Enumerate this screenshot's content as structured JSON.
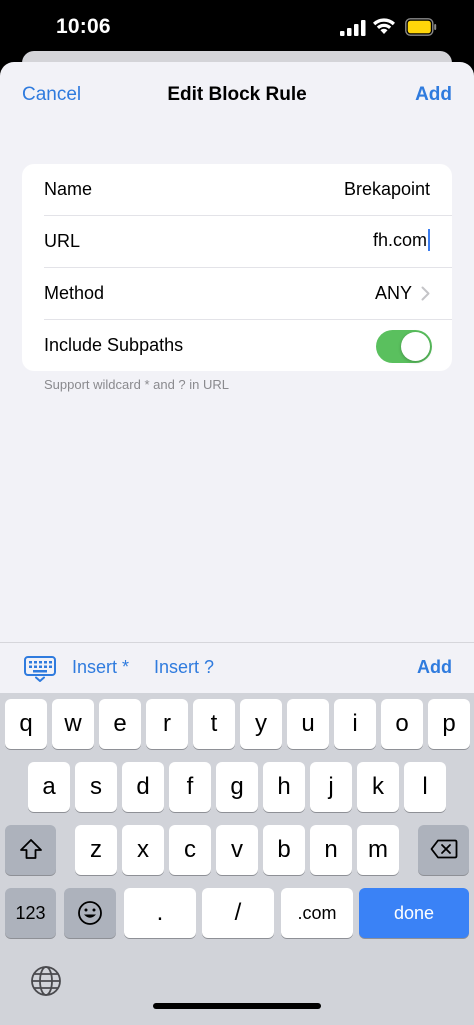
{
  "status": {
    "time": "10:06"
  },
  "nav": {
    "cancel": "Cancel",
    "title": "Edit Block Rule",
    "add": "Add"
  },
  "form": {
    "name_label": "Name",
    "name_value": "Brekapoint",
    "url_label": "URL",
    "url_value": "fh.com",
    "method_label": "Method",
    "method_value": "ANY",
    "subpaths_label": "Include Subpaths",
    "subpaths_on": true
  },
  "footnote": "Support wildcard * and ? in URL",
  "accessory": {
    "insert_star": "Insert *",
    "insert_question": "Insert ?",
    "add": "Add"
  },
  "keyboard": {
    "row1": [
      "q",
      "w",
      "e",
      "r",
      "t",
      "y",
      "u",
      "i",
      "o",
      "p"
    ],
    "row2": [
      "a",
      "s",
      "d",
      "f",
      "g",
      "h",
      "j",
      "k",
      "l"
    ],
    "row3": [
      "z",
      "x",
      "c",
      "v",
      "b",
      "n",
      "m"
    ],
    "numbers": "123",
    "dot": ".",
    "slash": "/",
    "dotcom": ".com",
    "done": "done"
  },
  "colors": {
    "accent": "#2f7bde",
    "toggle_on": "#5ac05e",
    "done_key": "#3a82f6",
    "battery": "#ffd60a"
  },
  "icons": [
    "signal-icon",
    "wifi-icon",
    "battery-icon",
    "chevron-right-icon",
    "keyboard-icon",
    "shift-icon",
    "delete-icon",
    "emoji-icon",
    "globe-icon"
  ]
}
